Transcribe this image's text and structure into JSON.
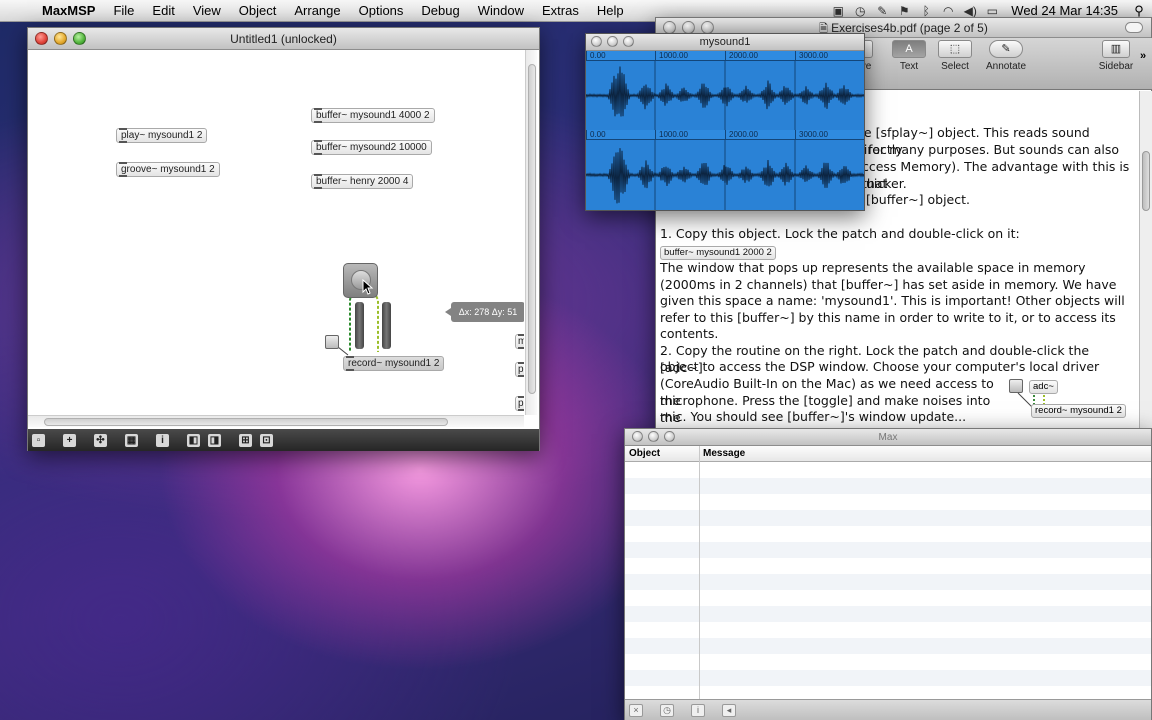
{
  "menubar": {
    "app_name": "MaxMSP",
    "items": [
      "File",
      "Edit",
      "View",
      "Object",
      "Arrange",
      "Options",
      "Debug",
      "Window",
      "Extras",
      "Help"
    ],
    "clock": "Wed 24 Mar  14:35"
  },
  "patcher": {
    "title": "Untitled1 (unlocked)",
    "objects": {
      "play": "play~ mysound1 2",
      "groove": "groove~ mysound1 2",
      "buffer1": "buffer~ mysound1 4000 2",
      "buffer2": "buffer~ mysound2 10000",
      "buffer3": "buffer~ henry 2000 4",
      "record": "record~ mysound1 2"
    },
    "delta_tooltip": "Δx: 278 Δy: 51",
    "edge_fragments": [
      "m",
      "p",
      "p"
    ]
  },
  "buffer_window": {
    "title": "mysound1",
    "ruler_labels": [
      "0.00",
      "1000.00",
      "2000.00",
      "3000.00"
    ],
    "wave_color": "#2a82d6"
  },
  "preview": {
    "title": "Exercises4b.pdf (page 2 of 5)",
    "toolbar": {
      "move_partial": "ve",
      "text": "Text",
      "select": "Select",
      "annotate": "Annotate",
      "sidebar": "Sidebar"
    },
    "doc": {
      "l1": "he [sfplay~] object. This reads sound directly",
      "l2": "for many purposes. But sounds can also",
      "l3": "ccess Memory). The advantage with this is that",
      "l4": "uicker.",
      "l5": "[buffer~] object.",
      "step1_text": "1. Copy this object. Lock the patch and double-click on it:",
      "step1_box": "buffer~ mysound1 2000 2",
      "para2": "The window that pops up represents the available space in memory (2000ms in 2 channels) that [buffer~] has set aside in memory. We have given this space a name: 'mysound1'. This is important! Other objects will refer to this [buffer~] by this name in order to write to it, or to access its contents.",
      "step2_a": "2. Copy the routine on the right. Lock the patch and double-click the [adc~]",
      "step2_b": "object to access the DSP window. Choose your computer's local driver",
      "step2_c": "(CoreAudio Built-In on the Mac) as we need access to the",
      "step2_d": "microphone. Press the [toggle] and make noises into the",
      "step2_e": "mic. You should see [buffer~]'s window update...",
      "adc_box": "adc~",
      "record_box": "record~ mysound1 2"
    }
  },
  "console": {
    "title": "Max",
    "col_object": "Object",
    "col_message": "Message"
  }
}
